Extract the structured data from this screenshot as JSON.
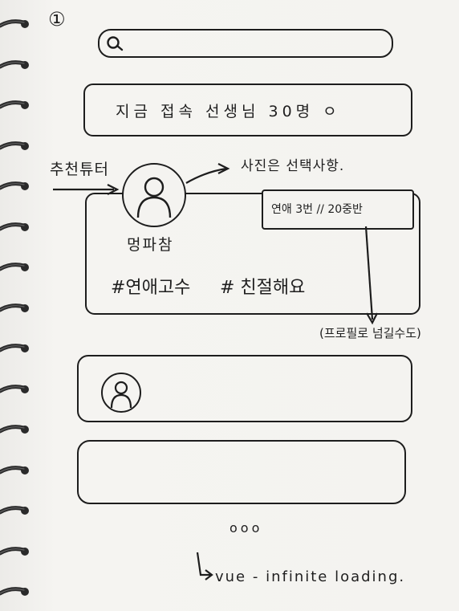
{
  "page_number": "①",
  "search": {
    "icon": "search-icon"
  },
  "online_banner": {
    "text": "지금 접속 선생님 30명 ㅇ"
  },
  "recommended_tutor": {
    "side_label": "추천튜터",
    "photo_note": "사진은 선택사항.",
    "name": "멍파참",
    "stats": "연애 3번 // 20중반",
    "tags": [
      "#연애고수",
      "# 친절해요"
    ],
    "annotation": "(프로필로 넘길수도)",
    "avatar_icon": "user-icon"
  },
  "list_card_avatar_icon": "user-icon",
  "ellipsis": "ooo",
  "footer_note": "vue - infinite loading."
}
